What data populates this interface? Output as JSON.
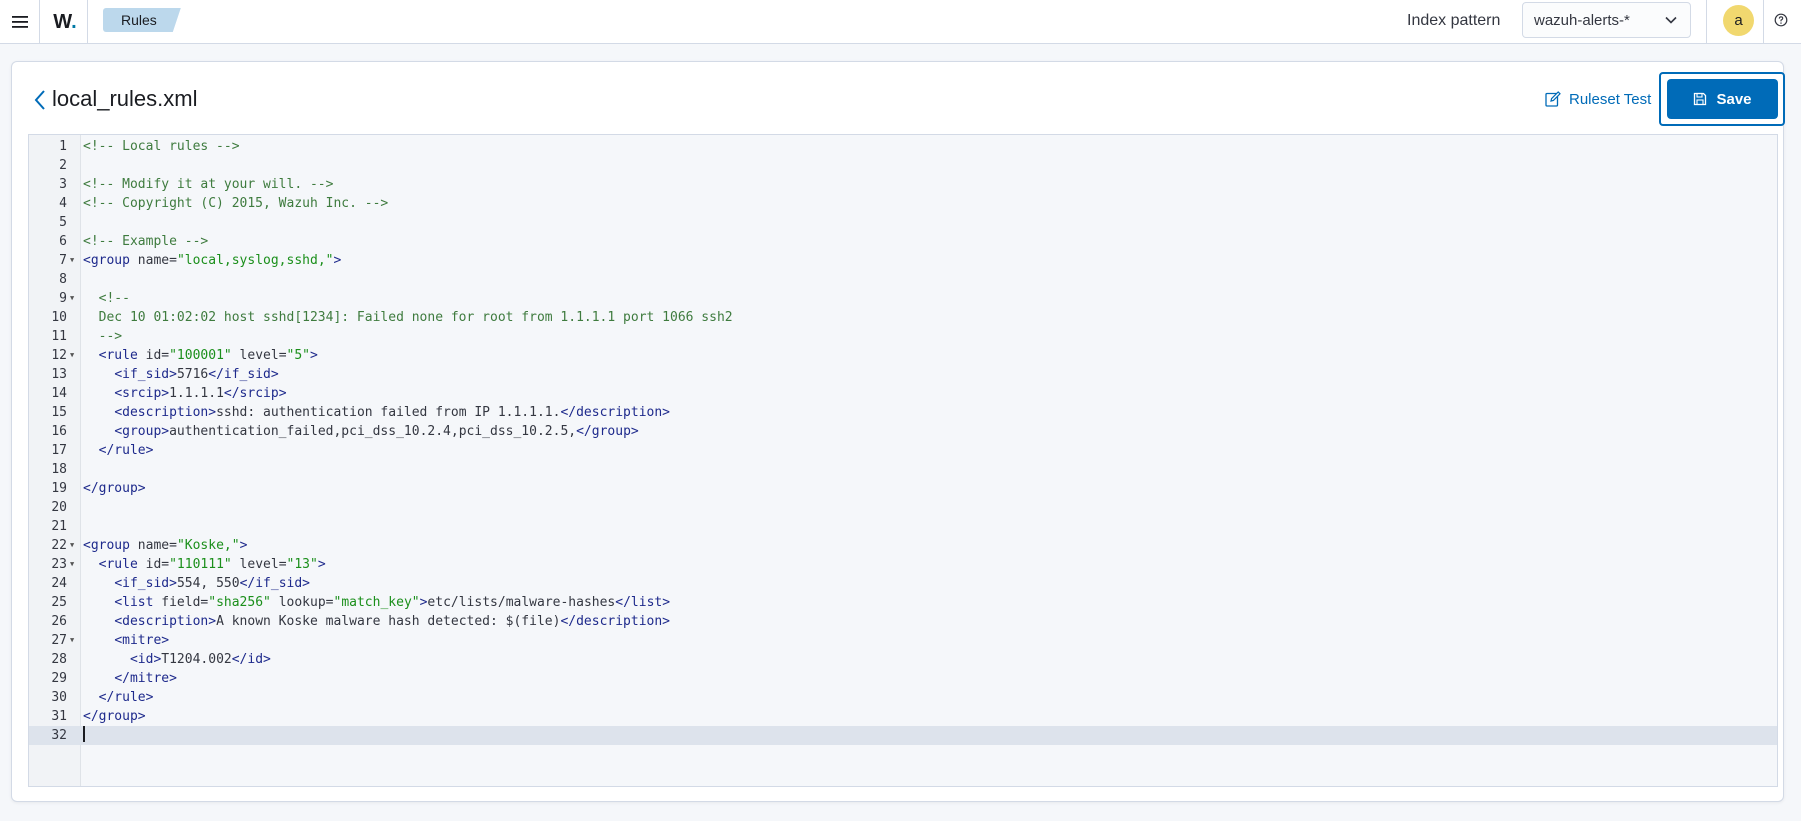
{
  "topbar": {
    "breadcrumb": "Rules",
    "index_pattern_label": "Index pattern",
    "index_pattern_value": "wazuh-alerts-*",
    "avatar_initial": "a",
    "logo_letter": "W",
    "logo_dot": "."
  },
  "file": {
    "title": "local_rules.xml",
    "ruleset_test_label": "Ruleset Test",
    "save_label": "Save"
  },
  "colors": {
    "primary": "#006bb8",
    "breadcrumb_bg": "#bcd8ec",
    "avatar_bg": "#f1d86f",
    "comment": "#3e7b3e",
    "tag": "#1e2a8c",
    "attr_value": "#1b8f1b"
  },
  "editor": {
    "active_line": 32,
    "lines": [
      {
        "n": "1",
        "fold": false,
        "tokens": [
          [
            "c",
            "<!-- Local rules -->"
          ]
        ]
      },
      {
        "n": "2",
        "fold": false,
        "tokens": []
      },
      {
        "n": "3",
        "fold": false,
        "tokens": [
          [
            "c",
            "<!-- Modify it at your will. -->"
          ]
        ]
      },
      {
        "n": "4",
        "fold": false,
        "tokens": [
          [
            "c",
            "<!-- Copyright (C) 2015, Wazuh Inc. -->"
          ]
        ]
      },
      {
        "n": "5",
        "fold": false,
        "tokens": []
      },
      {
        "n": "6",
        "fold": false,
        "tokens": [
          [
            "c",
            "<!-- Example -->"
          ]
        ]
      },
      {
        "n": "7",
        "fold": true,
        "tokens": [
          [
            "t",
            "<group"
          ],
          [
            "a",
            " name="
          ],
          [
            "v",
            "\"local,syslog,sshd,\""
          ],
          [
            "t",
            ">"
          ]
        ]
      },
      {
        "n": "8",
        "fold": false,
        "tokens": []
      },
      {
        "n": "9",
        "fold": true,
        "tokens": [
          [
            "c",
            "  <!--"
          ]
        ]
      },
      {
        "n": "10",
        "fold": false,
        "tokens": [
          [
            "c",
            "  Dec 10 01:02:02 host sshd[1234]: Failed none for root from 1.1.1.1 port 1066 ssh2"
          ]
        ]
      },
      {
        "n": "11",
        "fold": false,
        "tokens": [
          [
            "c",
            "  -->"
          ]
        ]
      },
      {
        "n": "12",
        "fold": true,
        "tokens": [
          [
            "a",
            "  "
          ],
          [
            "t",
            "<rule"
          ],
          [
            "a",
            " id="
          ],
          [
            "v",
            "\"100001\""
          ],
          [
            "a",
            " level="
          ],
          [
            "v",
            "\"5\""
          ],
          [
            "t",
            ">"
          ]
        ]
      },
      {
        "n": "13",
        "fold": false,
        "tokens": [
          [
            "a",
            "    "
          ],
          [
            "t",
            "<if_sid>"
          ],
          [
            "a",
            "5716"
          ],
          [
            "t",
            "</if_sid>"
          ]
        ]
      },
      {
        "n": "14",
        "fold": false,
        "tokens": [
          [
            "a",
            "    "
          ],
          [
            "t",
            "<srcip>"
          ],
          [
            "a",
            "1.1.1.1"
          ],
          [
            "t",
            "</srcip>"
          ]
        ]
      },
      {
        "n": "15",
        "fold": false,
        "tokens": [
          [
            "a",
            "    "
          ],
          [
            "t",
            "<description>"
          ],
          [
            "a",
            "sshd: authentication failed from IP 1.1.1.1."
          ],
          [
            "t",
            "</description>"
          ]
        ]
      },
      {
        "n": "16",
        "fold": false,
        "tokens": [
          [
            "a",
            "    "
          ],
          [
            "t",
            "<group>"
          ],
          [
            "a",
            "authentication_failed,pci_dss_10.2.4,pci_dss_10.2.5,"
          ],
          [
            "t",
            "</group>"
          ]
        ]
      },
      {
        "n": "17",
        "fold": false,
        "tokens": [
          [
            "a",
            "  "
          ],
          [
            "t",
            "</rule>"
          ]
        ]
      },
      {
        "n": "18",
        "fold": false,
        "tokens": []
      },
      {
        "n": "19",
        "fold": false,
        "tokens": [
          [
            "t",
            "</group>"
          ]
        ]
      },
      {
        "n": "20",
        "fold": false,
        "tokens": []
      },
      {
        "n": "21",
        "fold": false,
        "tokens": []
      },
      {
        "n": "22",
        "fold": true,
        "tokens": [
          [
            "t",
            "<group"
          ],
          [
            "a",
            " name="
          ],
          [
            "v",
            "\"Koske,\""
          ],
          [
            "t",
            ">"
          ]
        ]
      },
      {
        "n": "23",
        "fold": true,
        "tokens": [
          [
            "a",
            "  "
          ],
          [
            "t",
            "<rule"
          ],
          [
            "a",
            " id="
          ],
          [
            "v",
            "\"110111\""
          ],
          [
            "a",
            " level="
          ],
          [
            "v",
            "\"13\""
          ],
          [
            "t",
            ">"
          ]
        ]
      },
      {
        "n": "24",
        "fold": false,
        "tokens": [
          [
            "a",
            "    "
          ],
          [
            "t",
            "<if_sid>"
          ],
          [
            "a",
            "554, 550"
          ],
          [
            "t",
            "</if_sid>"
          ]
        ]
      },
      {
        "n": "25",
        "fold": false,
        "tokens": [
          [
            "a",
            "    "
          ],
          [
            "t",
            "<list"
          ],
          [
            "a",
            " field="
          ],
          [
            "v",
            "\"sha256\""
          ],
          [
            "a",
            " lookup="
          ],
          [
            "v",
            "\"match_key\""
          ],
          [
            "t",
            ">"
          ],
          [
            "a",
            "etc/lists/malware-hashes"
          ],
          [
            "t",
            "</list>"
          ]
        ]
      },
      {
        "n": "26",
        "fold": false,
        "tokens": [
          [
            "a",
            "    "
          ],
          [
            "t",
            "<description>"
          ],
          [
            "a",
            "A known Koske malware hash detected: $(file)"
          ],
          [
            "t",
            "</description>"
          ]
        ]
      },
      {
        "n": "27",
        "fold": true,
        "tokens": [
          [
            "a",
            "    "
          ],
          [
            "t",
            "<mitre>"
          ]
        ]
      },
      {
        "n": "28",
        "fold": false,
        "tokens": [
          [
            "a",
            "      "
          ],
          [
            "t",
            "<id>"
          ],
          [
            "a",
            "T1204.002"
          ],
          [
            "t",
            "</id>"
          ]
        ]
      },
      {
        "n": "29",
        "fold": false,
        "tokens": [
          [
            "a",
            "    "
          ],
          [
            "t",
            "</mitre>"
          ]
        ]
      },
      {
        "n": "30",
        "fold": false,
        "tokens": [
          [
            "a",
            "  "
          ],
          [
            "t",
            "</rule>"
          ]
        ]
      },
      {
        "n": "31",
        "fold": false,
        "tokens": [
          [
            "t",
            "</group>"
          ]
        ]
      },
      {
        "n": "32",
        "fold": false,
        "tokens": []
      }
    ]
  }
}
